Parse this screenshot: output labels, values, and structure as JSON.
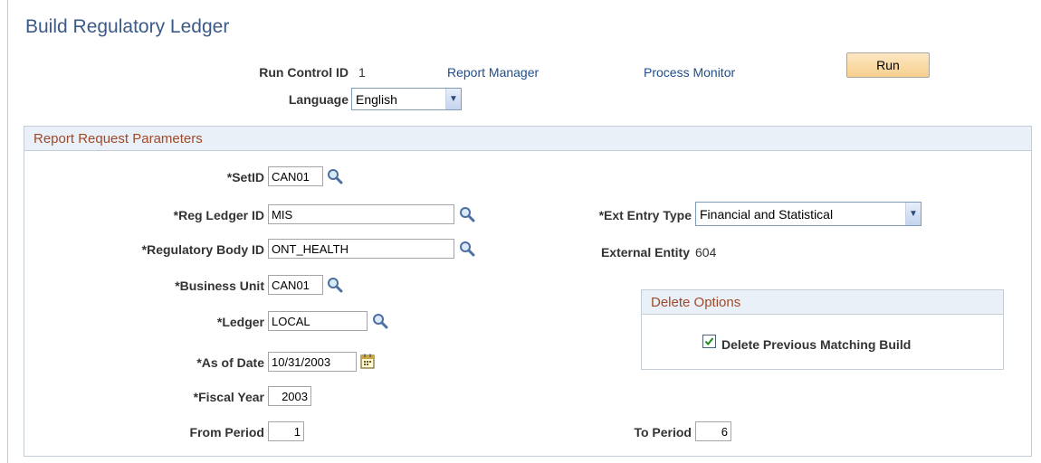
{
  "page": {
    "title": "Build Regulatory Ledger"
  },
  "header": {
    "run_control_label": "Run Control ID",
    "run_control_value": "1",
    "report_manager_link": "Report Manager",
    "process_monitor_link": "Process Monitor",
    "run_button": "Run",
    "language_label": "Language",
    "language_value": "English"
  },
  "params": {
    "section_title": "Report Request Parameters",
    "setid_label": "*SetID",
    "setid_value": "CAN01",
    "reg_ledger_label": "*Reg Ledger ID",
    "reg_ledger_value": "MIS",
    "reg_body_label": "*Regulatory Body ID",
    "reg_body_value": "ONT_HEALTH",
    "bu_label": "*Business Unit",
    "bu_value": "CAN01",
    "ledger_label": "*Ledger",
    "ledger_value": "LOCAL",
    "asof_label": "*As of Date",
    "asof_value": "10/31/2003",
    "fy_label": "*Fiscal Year",
    "fy_value": "2003",
    "from_label": "From Period",
    "from_value": "1",
    "ext_entry_label": "*Ext Entry Type",
    "ext_entry_value": "Financial and Statistical",
    "ext_entity_label": "External Entity",
    "ext_entity_value": "604",
    "to_label": "To Period",
    "to_value": "6"
  },
  "delete_options": {
    "title": "Delete Options",
    "checkbox_label": "Delete Previous Matching Build",
    "checked": true
  },
  "colors": {
    "title": "#3c5a88",
    "section_header_text": "#9e4a2a",
    "section_header_bg": "#eaf0f7",
    "link": "#1f4d8c",
    "run_button": "#f7cf8c"
  },
  "icons": [
    "lookup-icon",
    "calendar-icon",
    "dropdown-arrow-icon",
    "checkmark-icon"
  ]
}
